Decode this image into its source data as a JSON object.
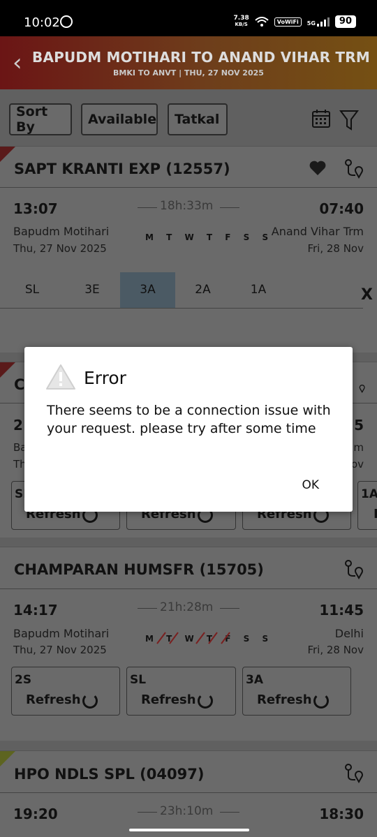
{
  "status": {
    "time": "10:02",
    "speed_top": "7.38",
    "speed_bottom": "KB/S",
    "vowifi": "VoWiFi",
    "net": "5G",
    "battery": "90"
  },
  "header": {
    "title": "BAPUDM MOTIHARI TO ANAND VIHAR TRM",
    "subtitle": "BMKI TO ANVT | THU, 27 NOV  2025"
  },
  "filters": {
    "sort": "Sort By",
    "available": "Available",
    "tatkal": "Tatkal"
  },
  "trains": [
    {
      "name": "SAPT KRANTI EXP (12557)",
      "dep": "13:07",
      "dur": "18h:33m",
      "arr": "07:40",
      "from": "Bapudm Motihari",
      "from_date": "Thu, 27 Nov  2025",
      "days": "M T W T F S S",
      "to": "Anand Vihar Trm",
      "to_date": "Fri, 28 Nov",
      "classes": [
        "SL",
        "3E",
        "3A",
        "2A",
        "1A"
      ],
      "close": "X"
    },
    {
      "name": "C",
      "dep": "21",
      "arr": "5",
      "from": "Ba",
      "from_date": "Th",
      "to": "m",
      "to_date": "ov",
      "boxes": [
        {
          "cls": "SL",
          "refresh": "Refresh"
        },
        {
          "cls": "",
          "refresh": "Refresh"
        },
        {
          "cls": "",
          "refresh": "Refresh"
        },
        {
          "cls": "1A",
          "refresh": "F"
        }
      ]
    },
    {
      "name": "CHAMPARAN HUMSFR (15705)",
      "dep": "14:17",
      "dur": "21h:28m",
      "arr": "11:45",
      "from": "Bapudm Motihari",
      "from_date": "Thu, 27 Nov  2025",
      "days": "M T W T F S S",
      "to": "Delhi",
      "to_date": "Fri, 28 Nov",
      "boxes": [
        {
          "cls": "2S",
          "refresh": "Refresh"
        },
        {
          "cls": "SL",
          "refresh": "Refresh"
        },
        {
          "cls": "3A",
          "refresh": "Refresh"
        }
      ]
    },
    {
      "name": "HPO NDLS SPL (04097)",
      "dep": "19:20",
      "dur": "23h:10m",
      "arr": "18:30"
    }
  ],
  "dialog": {
    "title": "Error",
    "message": "There seems to be a connection issue with your request. please try after some time",
    "ok": "OK"
  }
}
